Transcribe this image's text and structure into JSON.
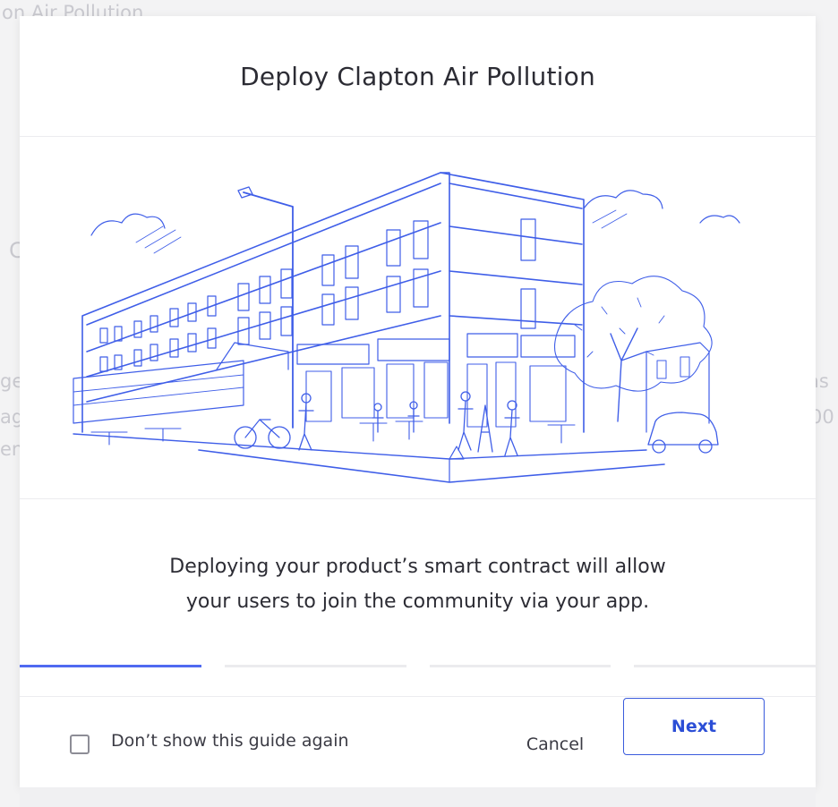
{
  "background": {
    "title_fragment": "on Air Pollution",
    "c_fragment": "C",
    "left_fragments": [
      "ge",
      "ag",
      "en"
    ],
    "right_fragments": [
      "as",
      "00"
    ]
  },
  "modal": {
    "title": "Deploy Clapton Air Pollution",
    "illustration": "street-corner-building-illustration",
    "description_line1": "Deploying your product’s smart contract will allow",
    "description_line2": "your users to join the community via your app.",
    "progress": {
      "total_steps": 4,
      "current_step": 1
    },
    "footer": {
      "checkbox_label": "Don’t show this guide again",
      "checkbox_checked": false,
      "cancel_label": "Cancel",
      "next_label": "Next"
    }
  },
  "colors": {
    "accent": "#4f6af1",
    "primary_button": "#2b4ed6",
    "illustration_ink": "#3f5ee8"
  }
}
